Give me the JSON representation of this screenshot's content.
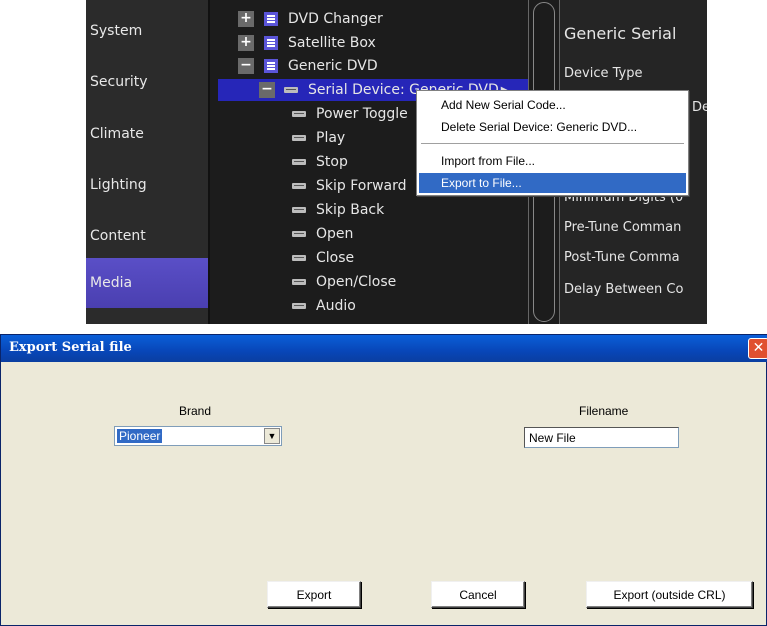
{
  "nav": {
    "items": [
      {
        "label": "System",
        "active": false
      },
      {
        "label": "Security",
        "active": false
      },
      {
        "label": "Climate",
        "active": false
      },
      {
        "label": "Lighting",
        "active": false
      },
      {
        "label": "Content",
        "active": false
      },
      {
        "label": "Media",
        "active": true
      }
    ]
  },
  "tree": {
    "dvd_changer": "DVD Changer",
    "satellite_box": "Satellite Box",
    "generic_dvd": "Generic DVD",
    "serial_device": "Serial Device: Generic DVD",
    "codes": [
      "Power Toggle",
      "Play",
      "Stop",
      "Skip Forward",
      "Skip Back",
      "Open",
      "Close",
      "Open/Close",
      "Audio"
    ],
    "expand_glyph": "+",
    "collapse_glyph": "−"
  },
  "properties": {
    "title": "Generic Serial",
    "device_type": "Device Type",
    "partial_label": "De",
    "minimum_digits": "Minimum Digits (0",
    "pre_tune": "Pre-Tune Comman",
    "post_tune": "Post-Tune Comma",
    "delay_between": "Delay Between Co"
  },
  "context_menu": {
    "items": [
      "Add New Serial Code...",
      "Delete Serial Device: Generic DVD...",
      "Import from File...",
      "Export to File..."
    ],
    "highlighted_index": 3
  },
  "dialog": {
    "title": "Export Serial file",
    "close_glyph": "✕",
    "brand_label": "Brand",
    "brand_value": "Pioneer",
    "filename_label": "Filename",
    "filename_value": "New File",
    "buttons": {
      "export": "Export",
      "cancel": "Cancel",
      "export_outside": "Export (outside CRL)"
    }
  },
  "colors": {
    "nav_active": "#5a4fc7",
    "tree_selected": "#2626b8",
    "menu_highlight": "#316ac5",
    "titlebar": "#0a5fd8",
    "dialog_bg": "#ece9d8"
  }
}
